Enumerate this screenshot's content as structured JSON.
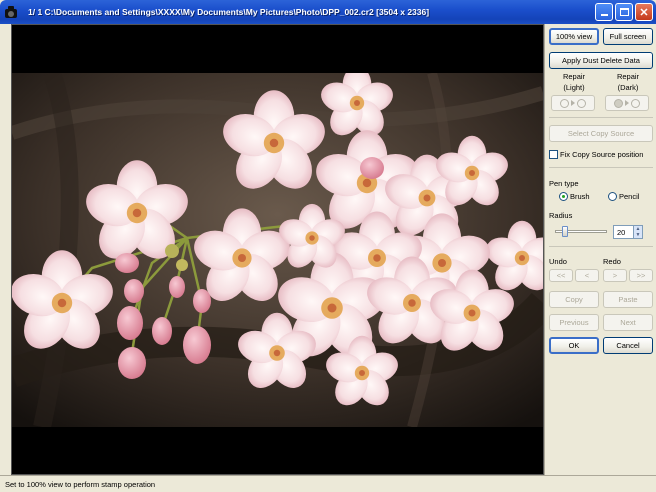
{
  "window": {
    "title": "1/ 1  C:\\Documents and Settings\\XXXX\\My Documents\\My Pictures\\Photo\\DPP_002.cr2 [3504 x 2336]",
    "app_icon": "camera-icon",
    "buttons": {
      "minimize": "minimize-icon",
      "maximize": "maximize-icon",
      "close": "✕"
    }
  },
  "panel": {
    "view_100": "100% view",
    "full_screen": "Full screen",
    "apply_dust": "Apply Dust Delete Data",
    "repair_light_label": "Repair\n(Light)",
    "repair_dark_label": "Repair\n(Dark)",
    "select_copy_source": "Select Copy Source",
    "fix_copy_source": "Fix Copy Source position",
    "fix_copy_source_checked": false,
    "pen_type_label": "Pen type",
    "pen_brush": "Brush",
    "pen_pencil": "Pencil",
    "pen_selected": "Brush",
    "radius_label": "Radius",
    "radius_value": "20",
    "radius_level": 0.2,
    "undo_label": "Undo",
    "redo_label": "Redo",
    "undo_all": "<<",
    "undo_one": "<",
    "redo_one": ">",
    "redo_all": ">>",
    "copy": "Copy",
    "paste": "Paste",
    "previous": "Previous",
    "next": "Next",
    "ok": "OK",
    "cancel": "Cancel"
  },
  "status": {
    "message": "Set to 100% view to perform stamp operation"
  },
  "colors": {
    "titlebar": "#1b4fcc",
    "panel_bg": "#ece9d8",
    "blossom": "#f7e4e8",
    "bud": "#e89aab",
    "stamen": "#e8a640"
  }
}
